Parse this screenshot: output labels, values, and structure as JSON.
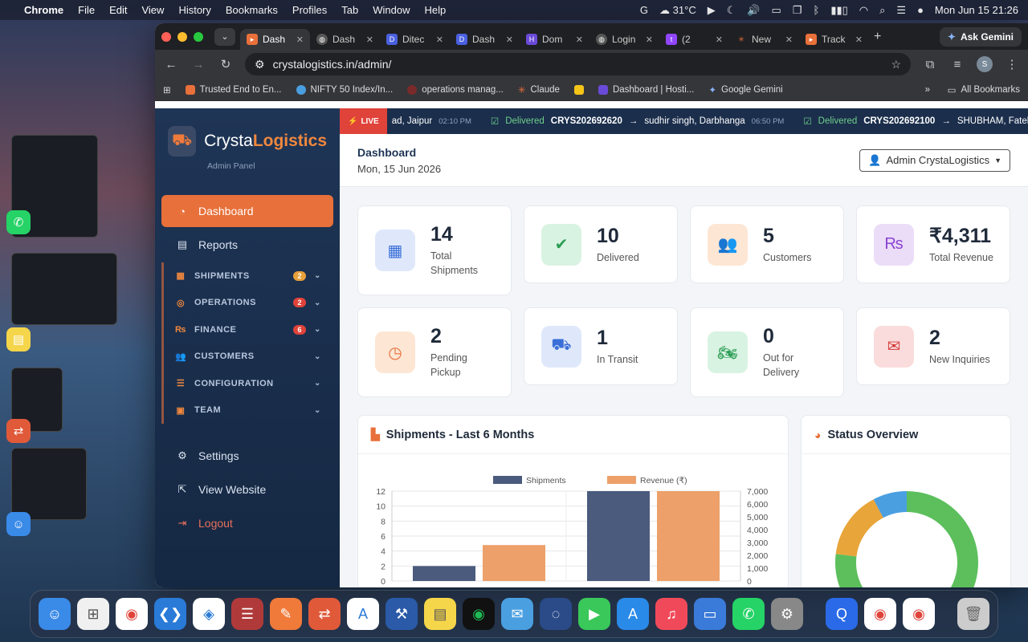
{
  "menubar": {
    "app": "Chrome",
    "menus": [
      "File",
      "Edit",
      "View",
      "History",
      "Bookmarks",
      "Profiles",
      "Tab",
      "Window",
      "Help"
    ],
    "weather": "31°C",
    "datetime": "Mon Jun 15  21:26"
  },
  "browser": {
    "tabs": [
      {
        "label": "Dash",
        "fav": "orange"
      },
      {
        "label": "Dash",
        "fav": "globe"
      },
      {
        "label": "Ditec",
        "fav": "blue-d"
      },
      {
        "label": "Dash",
        "fav": "blue-d"
      },
      {
        "label": "Dom",
        "fav": "purple"
      },
      {
        "label": "Login",
        "fav": "globe"
      },
      {
        "label": "(2",
        "fav": "twitch"
      },
      {
        "label": "New",
        "fav": "claude"
      },
      {
        "label": "Track",
        "fav": "orange"
      }
    ],
    "ask_gemini": "Ask Gemini",
    "url": "crystalogistics.in/admin/",
    "profile_initial": "S",
    "bookmarks": [
      "Trusted End to En...",
      "NIFTY 50 Index/In...",
      "operations manag...",
      "Claude",
      "Dashboard | Hosti...",
      "Google Gemini"
    ],
    "all_bookmarks": "All Bookmarks"
  },
  "sidebar": {
    "brand_first": "Crysta",
    "brand_second": "Logistics",
    "brand_sub": "Admin Panel",
    "dashboard": "Dashboard",
    "reports": "Reports",
    "groups": [
      {
        "label": "SHIPMENTS",
        "badge": "2",
        "badge_color": "#e8a03a"
      },
      {
        "label": "OPERATIONS",
        "badge": "2",
        "badge_color": "#e0433a"
      },
      {
        "label": "FINANCE",
        "badge": "6",
        "badge_color": "#e0433a"
      },
      {
        "label": "CUSTOMERS",
        "badge": "",
        "badge_color": ""
      },
      {
        "label": "CONFIGURATION",
        "badge": "",
        "badge_color": ""
      },
      {
        "label": "TEAM",
        "badge": "",
        "badge_color": ""
      }
    ],
    "settings": "Settings",
    "view_website": "View Website",
    "logout": "Logout"
  },
  "ticker": {
    "live": "LIVE",
    "items": [
      {
        "text": "ad, Jaipur",
        "time": "02:10 PM"
      },
      {
        "status": "Delivered",
        "id": "CRYS202692620",
        "dest": "sudhir singh, Darbhanga",
        "time": "06:50 PM"
      },
      {
        "status": "Delivered",
        "id": "CRYS202692100",
        "dest": "SHUBHAM, Fatehab"
      }
    ]
  },
  "header": {
    "title": "Dashboard",
    "date": "Mon, 15 Jun 2026",
    "admin": "Admin CrystaLogistics"
  },
  "stats": [
    {
      "value": "14",
      "label": "Total Shipments",
      "icon": "boxes-icon",
      "bg": "#dfe8fb",
      "fg": "#3b6fd8"
    },
    {
      "value": "10",
      "label": "Delivered",
      "icon": "check-circle-icon",
      "bg": "#d9f3e2",
      "fg": "#2e9e56"
    },
    {
      "value": "5",
      "label": "Customers",
      "icon": "users-icon",
      "bg": "#fde6d4",
      "fg": "#e8703a"
    },
    {
      "value": "₹4,311",
      "label": "Total Revenue",
      "icon": "rupee-icon",
      "bg": "#ebdcf8",
      "fg": "#8a44d0"
    },
    {
      "value": "2",
      "label": "Pending Pickup",
      "icon": "clock-icon",
      "bg": "#fde6d4",
      "fg": "#e8703a"
    },
    {
      "value": "1",
      "label": "In Transit",
      "icon": "truck-icon",
      "bg": "#dfe8fb",
      "fg": "#3b6fd8"
    },
    {
      "value": "0",
      "label": "Out for Delivery",
      "icon": "motorcycle-icon",
      "bg": "#d9f3e2",
      "fg": "#2e9e56"
    },
    {
      "value": "2",
      "label": "New Inquiries",
      "icon": "envelope-icon",
      "bg": "#fadcdc",
      "fg": "#d63b3b"
    }
  ],
  "panels": {
    "shipments_title": "Shipments - Last 6 Months",
    "status_title": "Status Overview"
  },
  "chart_data": [
    {
      "type": "bar",
      "title": "Shipments - Last 6 Months",
      "series": [
        {
          "name": "Shipments",
          "values": [
            2,
            12
          ],
          "color": "#4a5b7d"
        },
        {
          "name": "Revenue (₹)",
          "values": [
            2800,
            7000
          ],
          "color": "#eda06a"
        }
      ],
      "categories": [
        "",
        ""
      ],
      "ylim_left": [
        0,
        12
      ],
      "yticks_left": [
        0,
        2,
        4,
        6,
        8,
        10,
        12
      ],
      "ylim_right": [
        0,
        7000
      ],
      "yticks_right": [
        "0",
        "1,000",
        "2,000",
        "3,000",
        "4,000",
        "5,000",
        "6,000",
        "7,000"
      ],
      "legend": "top-center",
      "grid": true
    },
    {
      "type": "pie",
      "title": "Status Overview",
      "donut": true,
      "slices": [
        {
          "value": 10,
          "color": "#5cbf5c"
        },
        {
          "value": 2,
          "color": "#e8a53a"
        },
        {
          "value": 1,
          "color": "#4a9fe0"
        }
      ]
    }
  ]
}
